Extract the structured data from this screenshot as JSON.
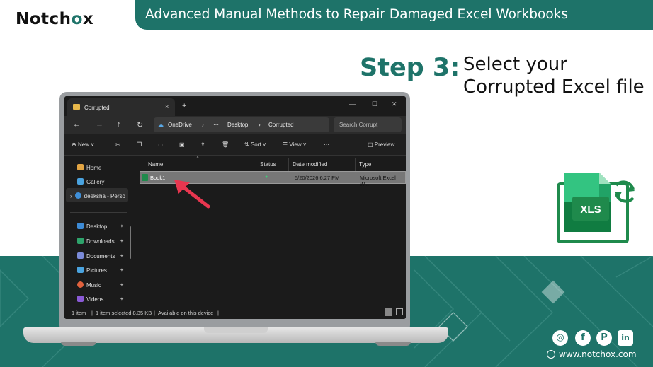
{
  "header": {
    "logo": "Notchox",
    "title": "Advanced Manual Methods to Repair Damaged Excel Workbooks"
  },
  "step": {
    "label": "Step 3:",
    "description": "Select your Corrupted Excel file"
  },
  "excel_icon": {
    "text": "XLS"
  },
  "explorer": {
    "tab_title": "Corrupted",
    "tab_close": "×",
    "new_tab": "+",
    "window_controls": [
      "—",
      "☐",
      "✕"
    ],
    "breadcrumb": [
      "OneDrive",
      "Desktop",
      "Corrupted"
    ],
    "breadcrumb_more": "···",
    "search_placeholder": "Search Corrupt",
    "commands": {
      "new": "New",
      "sort": "Sort",
      "view": "View",
      "more": "···",
      "preview": "Preview"
    },
    "nav": {
      "home": "Home",
      "gallery": "Gallery",
      "onedrive": "deeksha - Perso",
      "desktop": "Desktop",
      "downloads": "Downloads",
      "documents": "Documents",
      "pictures": "Pictures",
      "music": "Music",
      "videos": "Videos"
    },
    "columns": {
      "name": "Name",
      "status": "Status",
      "date": "Date modified",
      "type": "Type"
    },
    "files": [
      {
        "name": "Book1",
        "date": "5/20/2026 6:27 PM",
        "type": "Microsoft Excel W..."
      }
    ],
    "statusbar": {
      "count": "1 item",
      "selected": "1 item selected  8.35 KB",
      "availability": "Available on this device"
    }
  },
  "footer": {
    "website": "www.notchox.com",
    "social": [
      "instagram-icon",
      "facebook-icon",
      "pinterest-icon",
      "linkedin-icon"
    ]
  },
  "colors": {
    "brand": "#1e7369",
    "excel": "#1f8a4c"
  }
}
